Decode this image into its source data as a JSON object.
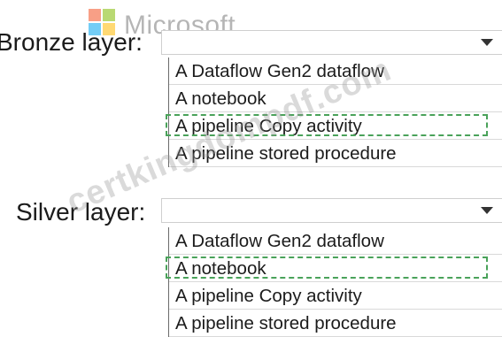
{
  "logo": {
    "text": "Microsoft",
    "colors": [
      "#f25022",
      "#7fba00",
      "#00a4ef",
      "#ffb900"
    ]
  },
  "watermark": {
    "text": "certkingdompdf.com"
  },
  "bronze": {
    "label": "Bronze layer:",
    "selected_value": "",
    "options": [
      {
        "label": "A Dataflow Gen2 dataflow",
        "selected": false
      },
      {
        "label": "A notebook",
        "selected": false
      },
      {
        "label": "A pipeline Copy activity",
        "selected": true
      },
      {
        "label": "A pipeline stored procedure",
        "selected": false
      }
    ]
  },
  "silver": {
    "label": "Silver layer:",
    "selected_value": "",
    "options": [
      {
        "label": "A Dataflow Gen2 dataflow",
        "selected": false
      },
      {
        "label": "A notebook",
        "selected": true
      },
      {
        "label": "A pipeline Copy activity",
        "selected": false
      },
      {
        "label": "A pipeline stored procedure",
        "selected": false
      }
    ]
  },
  "accent": {
    "selection_border": "#4aa25a",
    "chevron": "#333333"
  }
}
